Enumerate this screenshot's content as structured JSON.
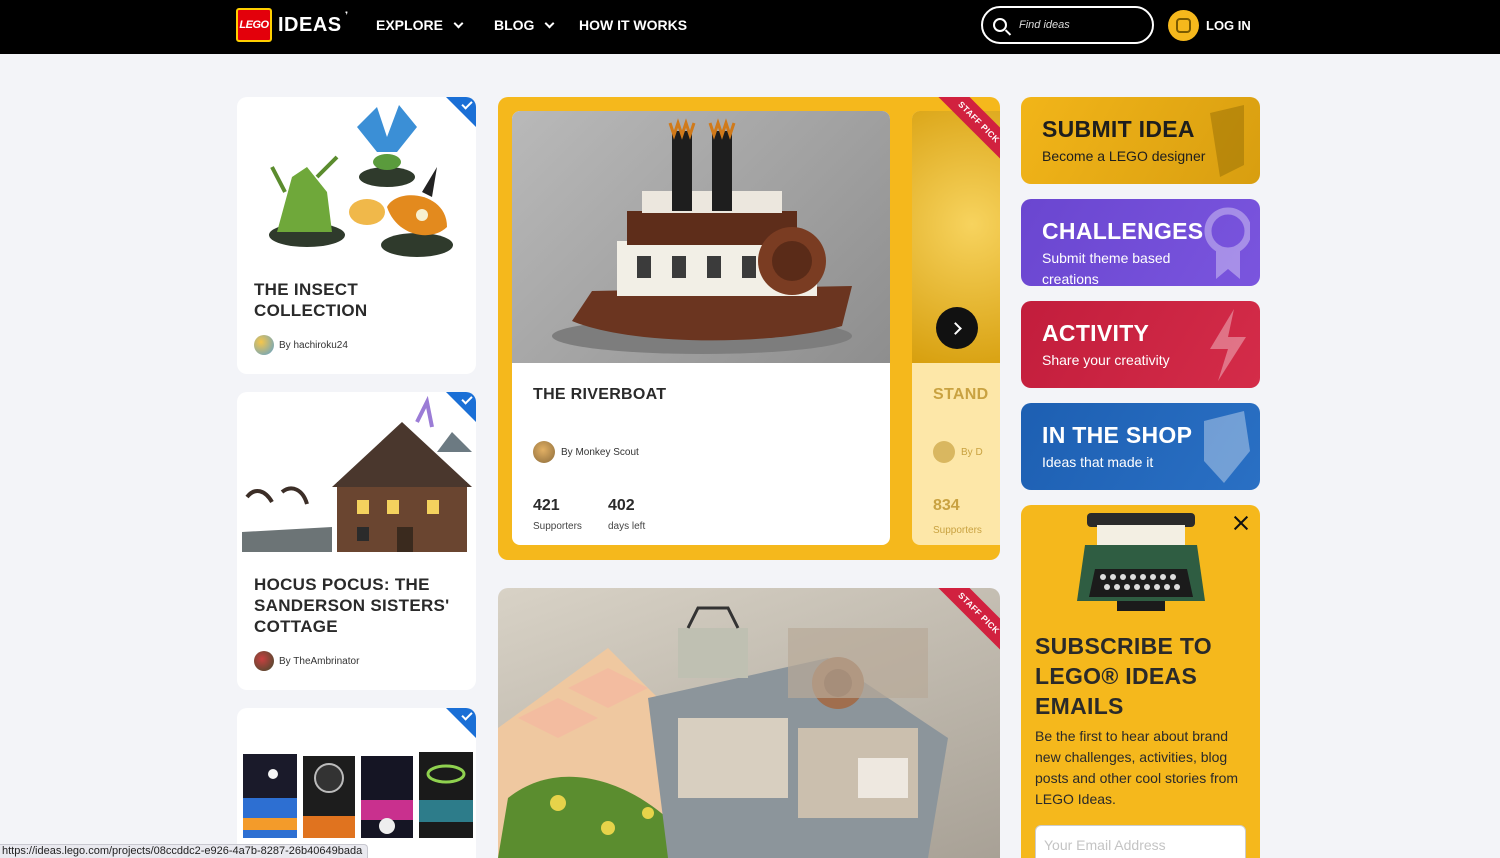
{
  "nav": {
    "logo_brand": "LEGO",
    "logo_text": "IDEAS",
    "items": [
      {
        "label": "EXPLORE",
        "has_dropdown": true
      },
      {
        "label": "BLOG",
        "has_dropdown": true
      },
      {
        "label": "HOW IT WORKS",
        "has_dropdown": false
      }
    ],
    "search_placeholder": "Find ideas",
    "login_label": "LOG IN"
  },
  "left_projects": [
    {
      "title": "THE INSECT COLLECTION",
      "author": "By hachiroku24"
    },
    {
      "title": "HOCUS POCUS: THE SANDERSON SISTERS' COTTAGE",
      "author": "By TheAmbrinator"
    },
    {
      "title": "",
      "author": ""
    }
  ],
  "featured": {
    "badge": "STAFF PICK",
    "current": {
      "title": "THE RIVERBOAT",
      "author": "By Monkey Scout",
      "supporters": "421",
      "supporters_label": "Supporters",
      "days_left": "402",
      "days_left_label": "days left"
    },
    "next": {
      "title_partial": "STAND",
      "author_partial": "By D",
      "supporters": "834",
      "supporters_label": "Supporters"
    }
  },
  "second_feature": {
    "badge": "STAFF PICK"
  },
  "tiles": [
    {
      "title": "SUBMIT IDEA",
      "subtitle": "Become a LEGO designer",
      "color": "#e6a914"
    },
    {
      "title": "CHALLENGES",
      "subtitle": "Submit theme based creations",
      "color": "#6b48cf"
    },
    {
      "title": "ACTIVITY",
      "subtitle": "Share your creativity",
      "color": "#c8213e"
    },
    {
      "title": "IN THE SHOP",
      "subtitle": "Ideas that made it",
      "color": "#1f63b5"
    }
  ],
  "subscribe": {
    "title": "SUBSCRIBE TO LEGO® IDEAS EMAILS",
    "body": "Be the first to hear about brand new challenges, activities, blog posts and other cool stories from LEGO Ideas.",
    "email_placeholder": "Your Email Address"
  },
  "status_url": "https://ideas.lego.com/projects/08ccddc2-e926-4a7b-8287-26b40649bada",
  "colors": {
    "accent_yellow": "#f5b81c",
    "nav_bg": "#000000",
    "staff_pick": "#d1213f",
    "corner_badge": "#1a6fd6"
  }
}
